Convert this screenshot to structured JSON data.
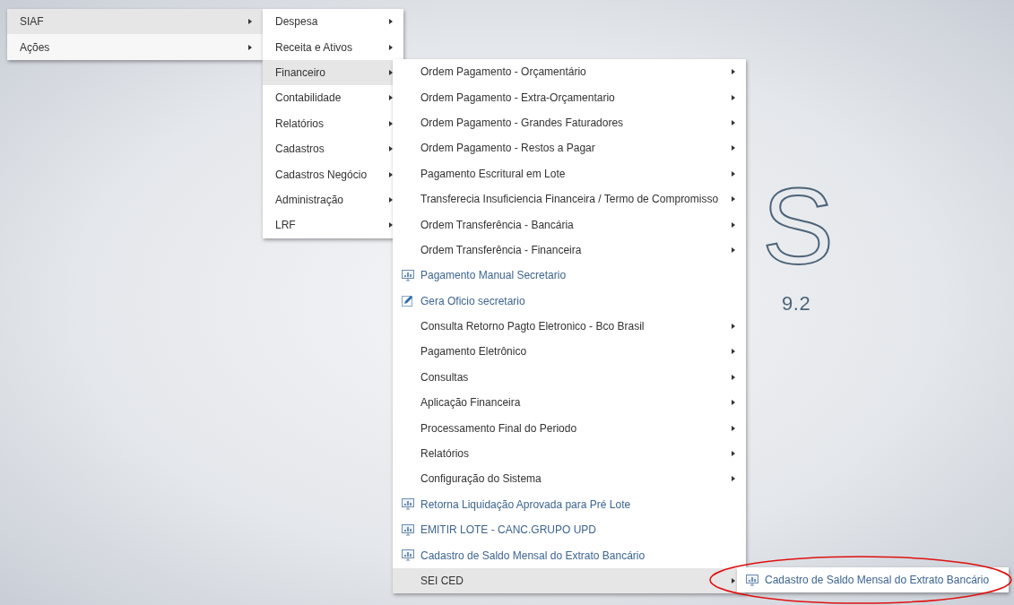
{
  "logo": {
    "letter": "S",
    "version": "9.2"
  },
  "menus": [
    {
      "items": [
        {
          "label": "SIAF",
          "kind": "submenu",
          "selected": true
        },
        {
          "label": "Ações",
          "kind": "submenu",
          "selected": false
        }
      ]
    },
    {
      "items": [
        {
          "label": "Despesa",
          "kind": "submenu",
          "selected": false
        },
        {
          "label": "Receita e Ativos",
          "kind": "submenu",
          "selected": false
        },
        {
          "label": "Financeiro",
          "kind": "submenu",
          "selected": true
        },
        {
          "label": "Contabilidade",
          "kind": "submenu",
          "selected": false
        },
        {
          "label": "Relatórios",
          "kind": "submenu",
          "selected": false
        },
        {
          "label": "Cadastros",
          "kind": "submenu",
          "selected": false
        },
        {
          "label": "Cadastros Negócio",
          "kind": "submenu",
          "selected": false
        },
        {
          "label": "Administração",
          "kind": "submenu",
          "selected": false
        },
        {
          "label": "LRF",
          "kind": "submenu",
          "selected": false
        }
      ]
    },
    {
      "items": [
        {
          "label": "Ordem Pagamento - Orçamentário",
          "kind": "submenu",
          "selected": false
        },
        {
          "label": "Ordem Pagamento - Extra-Orçamentario",
          "kind": "submenu",
          "selected": false
        },
        {
          "label": "Ordem Pagamento - Grandes Faturadores",
          "kind": "submenu",
          "selected": false
        },
        {
          "label": "Ordem Pagamento - Restos a Pagar",
          "kind": "submenu",
          "selected": false
        },
        {
          "label": "Pagamento Escritural em Lote",
          "kind": "submenu",
          "selected": false
        },
        {
          "label": "Transferecia Insuficiencia Financeira / Termo de Compromisso",
          "kind": "submenu",
          "selected": false
        },
        {
          "label": "Ordem Transferência - Bancária",
          "kind": "submenu",
          "selected": false
        },
        {
          "label": "Ordem Transferência - Financeira",
          "kind": "submenu",
          "selected": false
        },
        {
          "label": "Pagamento Manual Secretario",
          "kind": "report",
          "selected": false
        },
        {
          "label": "Gera Oficio secretario",
          "kind": "form",
          "selected": false
        },
        {
          "label": "Consulta Retorno Pagto Eletronico - Bco Brasil",
          "kind": "submenu",
          "selected": false
        },
        {
          "label": "Pagamento Eletrônico",
          "kind": "submenu",
          "selected": false
        },
        {
          "label": "Consultas",
          "kind": "submenu",
          "selected": false
        },
        {
          "label": "Aplicação Financeira",
          "kind": "submenu",
          "selected": false
        },
        {
          "label": "Processamento Final do Periodo",
          "kind": "submenu",
          "selected": false
        },
        {
          "label": "Relatórios",
          "kind": "submenu",
          "selected": false
        },
        {
          "label": "Configuração do Sistema",
          "kind": "submenu",
          "selected": false
        },
        {
          "label": "Retorna Liquidação Aprovada para Pré Lote",
          "kind": "report",
          "selected": false
        },
        {
          "label": "EMITIR LOTE - CANC.GRUPO UPD",
          "kind": "report",
          "selected": false
        },
        {
          "label": "Cadastro de Saldo Mensal do Extrato Bancário",
          "kind": "report",
          "selected": false
        },
        {
          "label": "SEI CED",
          "kind": "submenu",
          "selected": true
        }
      ]
    },
    {
      "items": [
        {
          "label": "Cadastro de Saldo Mensal do Extrato Bancário",
          "kind": "report",
          "selected": false
        }
      ]
    }
  ]
}
